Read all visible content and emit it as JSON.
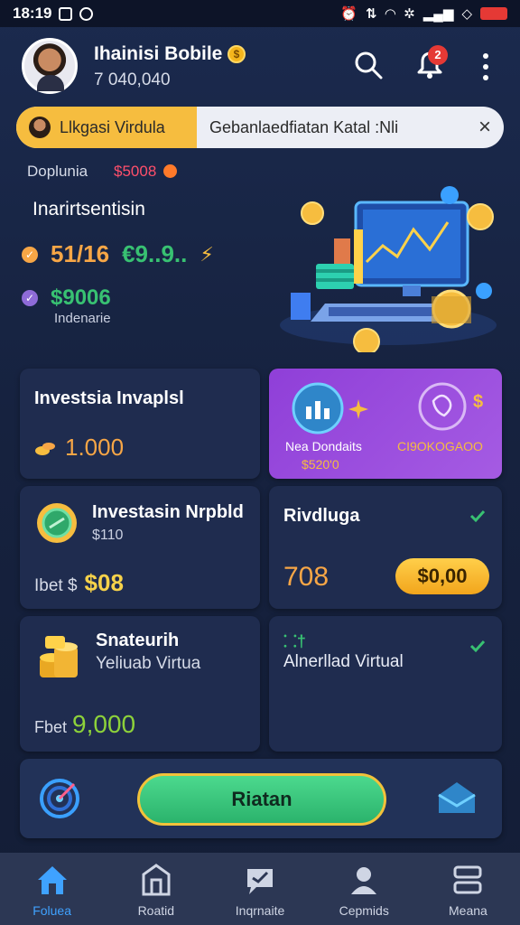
{
  "status_bar": {
    "time": "18:19"
  },
  "header": {
    "user_name": "Ihainisi Bobile",
    "user_balance": "7 040,040",
    "notification_count": "2"
  },
  "banner": {
    "left_label": "Llkgasi Virdula",
    "text": "Gebanlaedfiatan Katal :Nli",
    "close": "×"
  },
  "hero": {
    "label": "Doplunia",
    "label_amount": "$5008",
    "heading": "Inarirtsentisin",
    "value_1": "51/16",
    "value_1b": "€9..9..",
    "value_2": "$9006",
    "value_2_sub": "Indenarie"
  },
  "cards": {
    "invest": {
      "title": "Investsia Invaplsl",
      "amount": "1.000"
    },
    "promo": {
      "label": "Nea Dondaits",
      "sub": "$520'0",
      "code": "CI9OKOGAOO",
      "dollar": "$"
    },
    "investasin": {
      "title": "Investasin Nrpbld",
      "sub": "$110",
      "bet_label": "Ibet $",
      "bet_value": "$08"
    },
    "rivdluga": {
      "title": "Rivdluga",
      "value": "708",
      "button": "$0,00"
    },
    "snateurih": {
      "title": "Snateurih",
      "sub": "Yeliuab Virtua",
      "bet_label": "Fbet",
      "bet_value": "9,000"
    },
    "alnerllad": {
      "icon_text": "⸬†",
      "sub": "Alnerllad Virtual"
    }
  },
  "action_bar": {
    "button": "Riatan"
  },
  "bottom_nav": [
    {
      "label": "Foluea",
      "icon": "home-icon",
      "active": true
    },
    {
      "label": "Roatid",
      "icon": "building-icon",
      "active": false
    },
    {
      "label": "Inqrnaite",
      "icon": "chat-icon",
      "active": false
    },
    {
      "label": "Cepmids",
      "icon": "profile-icon",
      "active": false
    },
    {
      "label": "Meana",
      "icon": "menu-icon",
      "active": false
    }
  ],
  "colors": {
    "background": "#1b2a4e",
    "card": "#1f2c4f",
    "promo_card": "#8f3fd8",
    "accent_gold": "#f6bd3f",
    "accent_green": "#38c172",
    "active_nav": "#3fa2ff"
  }
}
